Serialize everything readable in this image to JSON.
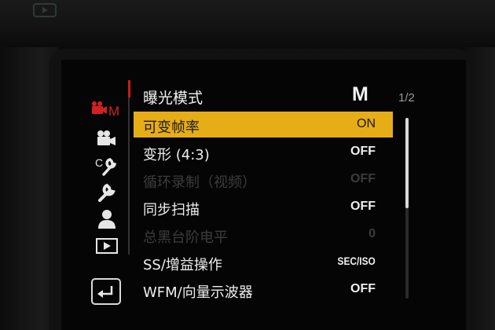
{
  "menu": {
    "title": "曝光模式",
    "title_value": "M",
    "page_indicator": "1/2",
    "scroll_fraction": 0.5,
    "items": [
      {
        "label": "可变帧率",
        "value": "ON",
        "state": "selected"
      },
      {
        "label": "变形 (4:3)",
        "value": "OFF",
        "state": "normal"
      },
      {
        "label": "循环录制（视频）",
        "value": "OFF",
        "state": "disabled"
      },
      {
        "label": "同步扫描",
        "value": "OFF",
        "state": "normal"
      },
      {
        "label": "总黑台阶电平",
        "value": "0",
        "state": "disabled"
      },
      {
        "label": "SS/增益操作",
        "value": "SEC/ISO",
        "state": "normal"
      },
      {
        "label": "WFM/向量示波器",
        "value": "OFF",
        "state": "normal"
      }
    ]
  },
  "tabs": [
    {
      "name": "tab-video-m",
      "icon": "video-camera-m-icon",
      "label": "M",
      "active": true
    },
    {
      "name": "tab-video",
      "icon": "video-camera-icon",
      "active": false
    },
    {
      "name": "tab-custom",
      "icon": "custom-wrench-icon",
      "label": "C",
      "active": false
    },
    {
      "name": "tab-setup",
      "icon": "wrench-icon",
      "active": false
    },
    {
      "name": "tab-my-menu",
      "icon": "person-icon",
      "active": false
    },
    {
      "name": "tab-playback",
      "icon": "playback-icon",
      "active": false
    }
  ],
  "colors": {
    "highlight": "#e7ad16",
    "active_tab": "#c81b1b",
    "text": "#eeeeee",
    "disabled_text": "#3c3c3c"
  }
}
